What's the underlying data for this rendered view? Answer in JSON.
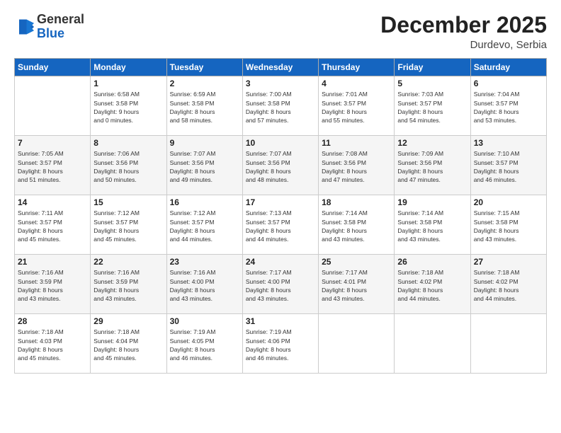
{
  "header": {
    "logo": {
      "general": "General",
      "blue": "Blue"
    },
    "title": "December 2025",
    "subtitle": "Durdevo, Serbia"
  },
  "weekdays": [
    "Sunday",
    "Monday",
    "Tuesday",
    "Wednesday",
    "Thursday",
    "Friday",
    "Saturday"
  ],
  "weeks": [
    [
      {
        "day": "",
        "info": ""
      },
      {
        "day": "1",
        "info": "Sunrise: 6:58 AM\nSunset: 3:58 PM\nDaylight: 9 hours\nand 0 minutes."
      },
      {
        "day": "2",
        "info": "Sunrise: 6:59 AM\nSunset: 3:58 PM\nDaylight: 8 hours\nand 58 minutes."
      },
      {
        "day": "3",
        "info": "Sunrise: 7:00 AM\nSunset: 3:58 PM\nDaylight: 8 hours\nand 57 minutes."
      },
      {
        "day": "4",
        "info": "Sunrise: 7:01 AM\nSunset: 3:57 PM\nDaylight: 8 hours\nand 55 minutes."
      },
      {
        "day": "5",
        "info": "Sunrise: 7:03 AM\nSunset: 3:57 PM\nDaylight: 8 hours\nand 54 minutes."
      },
      {
        "day": "6",
        "info": "Sunrise: 7:04 AM\nSunset: 3:57 PM\nDaylight: 8 hours\nand 53 minutes."
      }
    ],
    [
      {
        "day": "7",
        "info": "Sunrise: 7:05 AM\nSunset: 3:57 PM\nDaylight: 8 hours\nand 51 minutes."
      },
      {
        "day": "8",
        "info": "Sunrise: 7:06 AM\nSunset: 3:56 PM\nDaylight: 8 hours\nand 50 minutes."
      },
      {
        "day": "9",
        "info": "Sunrise: 7:07 AM\nSunset: 3:56 PM\nDaylight: 8 hours\nand 49 minutes."
      },
      {
        "day": "10",
        "info": "Sunrise: 7:07 AM\nSunset: 3:56 PM\nDaylight: 8 hours\nand 48 minutes."
      },
      {
        "day": "11",
        "info": "Sunrise: 7:08 AM\nSunset: 3:56 PM\nDaylight: 8 hours\nand 47 minutes."
      },
      {
        "day": "12",
        "info": "Sunrise: 7:09 AM\nSunset: 3:56 PM\nDaylight: 8 hours\nand 47 minutes."
      },
      {
        "day": "13",
        "info": "Sunrise: 7:10 AM\nSunset: 3:57 PM\nDaylight: 8 hours\nand 46 minutes."
      }
    ],
    [
      {
        "day": "14",
        "info": "Sunrise: 7:11 AM\nSunset: 3:57 PM\nDaylight: 8 hours\nand 45 minutes."
      },
      {
        "day": "15",
        "info": "Sunrise: 7:12 AM\nSunset: 3:57 PM\nDaylight: 8 hours\nand 45 minutes."
      },
      {
        "day": "16",
        "info": "Sunrise: 7:12 AM\nSunset: 3:57 PM\nDaylight: 8 hours\nand 44 minutes."
      },
      {
        "day": "17",
        "info": "Sunrise: 7:13 AM\nSunset: 3:57 PM\nDaylight: 8 hours\nand 44 minutes."
      },
      {
        "day": "18",
        "info": "Sunrise: 7:14 AM\nSunset: 3:58 PM\nDaylight: 8 hours\nand 43 minutes."
      },
      {
        "day": "19",
        "info": "Sunrise: 7:14 AM\nSunset: 3:58 PM\nDaylight: 8 hours\nand 43 minutes."
      },
      {
        "day": "20",
        "info": "Sunrise: 7:15 AM\nSunset: 3:58 PM\nDaylight: 8 hours\nand 43 minutes."
      }
    ],
    [
      {
        "day": "21",
        "info": "Sunrise: 7:16 AM\nSunset: 3:59 PM\nDaylight: 8 hours\nand 43 minutes."
      },
      {
        "day": "22",
        "info": "Sunrise: 7:16 AM\nSunset: 3:59 PM\nDaylight: 8 hours\nand 43 minutes."
      },
      {
        "day": "23",
        "info": "Sunrise: 7:16 AM\nSunset: 4:00 PM\nDaylight: 8 hours\nand 43 minutes."
      },
      {
        "day": "24",
        "info": "Sunrise: 7:17 AM\nSunset: 4:00 PM\nDaylight: 8 hours\nand 43 minutes."
      },
      {
        "day": "25",
        "info": "Sunrise: 7:17 AM\nSunset: 4:01 PM\nDaylight: 8 hours\nand 43 minutes."
      },
      {
        "day": "26",
        "info": "Sunrise: 7:18 AM\nSunset: 4:02 PM\nDaylight: 8 hours\nand 44 minutes."
      },
      {
        "day": "27",
        "info": "Sunrise: 7:18 AM\nSunset: 4:02 PM\nDaylight: 8 hours\nand 44 minutes."
      }
    ],
    [
      {
        "day": "28",
        "info": "Sunrise: 7:18 AM\nSunset: 4:03 PM\nDaylight: 8 hours\nand 45 minutes."
      },
      {
        "day": "29",
        "info": "Sunrise: 7:18 AM\nSunset: 4:04 PM\nDaylight: 8 hours\nand 45 minutes."
      },
      {
        "day": "30",
        "info": "Sunrise: 7:19 AM\nSunset: 4:05 PM\nDaylight: 8 hours\nand 46 minutes."
      },
      {
        "day": "31",
        "info": "Sunrise: 7:19 AM\nSunset: 4:06 PM\nDaylight: 8 hours\nand 46 minutes."
      },
      {
        "day": "",
        "info": ""
      },
      {
        "day": "",
        "info": ""
      },
      {
        "day": "",
        "info": ""
      }
    ]
  ]
}
